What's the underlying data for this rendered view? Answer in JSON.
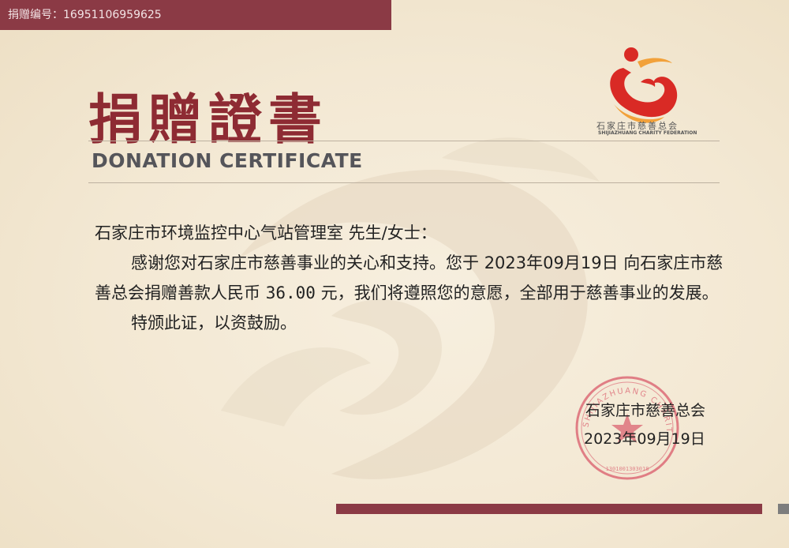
{
  "header": {
    "donation_number": "捐赠编号：16951106959625"
  },
  "title": {
    "chinese": "捐贈證書",
    "english": "DONATION CERTIFICATE"
  },
  "logo": {
    "name_cn": "石家庄市慈善总会",
    "name_en": "SHIJIAZHUANG CHARITY FEDERATION"
  },
  "certificate": {
    "salutation": "石家庄市环境监控中心气站管理室 先生/女士：",
    "text_a": "感谢您对石家庄市慈善事业的关心和支持。您于 ",
    "date": "2023年09月19日",
    "text_b": " 向石家庄市慈善总会捐赠善款人民币 ",
    "amount": "36.00",
    "text_c": "  元，我们将遵照您的意愿，全部用于慈善事业的发展。",
    "closing": "特颁此证，以资鼓励。"
  },
  "signature": {
    "organization": "石家庄市慈善总会",
    "date": "2023年09月19日"
  },
  "seal": {
    "text": "SHIJIAZHUANG CHARITY FEDERATION",
    "number": "1301001303018",
    "color": "#d95a6a"
  },
  "colors": {
    "brand": "#8b3a45",
    "title": "#8e2b33",
    "logo_red": "#d92a25",
    "logo_orange": "#f2a13a"
  }
}
